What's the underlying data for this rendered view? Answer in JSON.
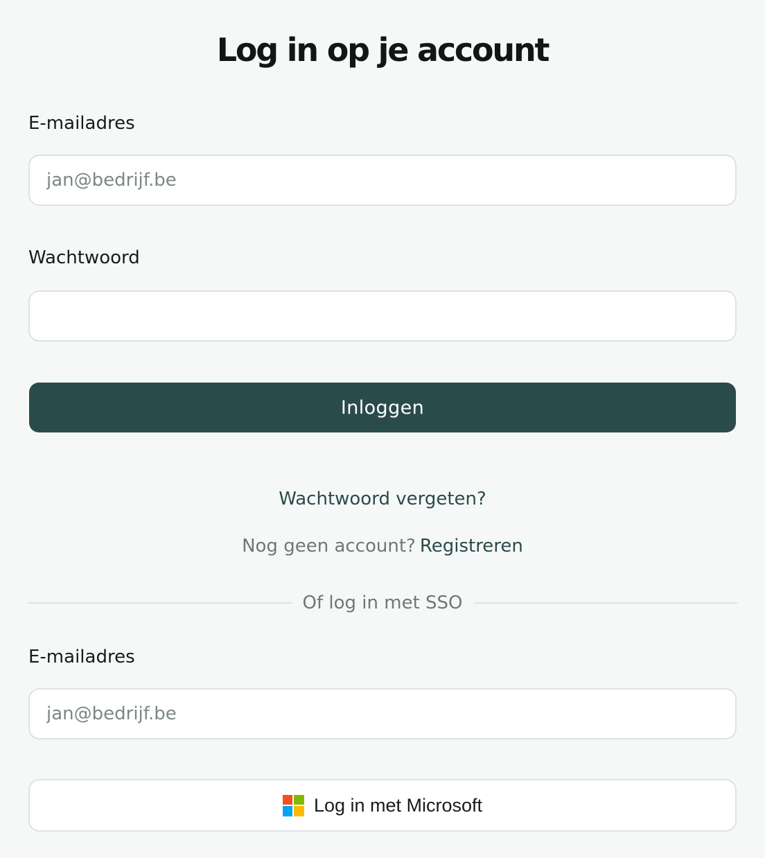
{
  "page": {
    "title": "Log in op je account"
  },
  "login_form": {
    "email_label": "E-mailadres",
    "email_placeholder": "jan@bedrijf.be",
    "email_value": "",
    "password_label": "Wachtwoord",
    "password_value": "",
    "submit_label": "Inloggen"
  },
  "links": {
    "forgot_password": "Wachtwoord vergeten?",
    "no_account_text": "Nog geen account?",
    "register": "Registreren"
  },
  "sso": {
    "divider_text": "Of log in met SSO",
    "email_label": "E-mailadres",
    "email_placeholder": "jan@bedrijf.be",
    "email_value": "",
    "microsoft_button_label": "Log in met Microsoft",
    "microsoft_icon": "microsoft-logo-icon"
  },
  "colors": {
    "background": "#f6f8f7",
    "primary": "#2a4b4b",
    "link": "#2a4b4b",
    "muted_text": "#6f7875",
    "ms_red": "#f25022",
    "ms_green": "#7fba00",
    "ms_blue": "#00a4ef",
    "ms_yellow": "#ffb900"
  }
}
